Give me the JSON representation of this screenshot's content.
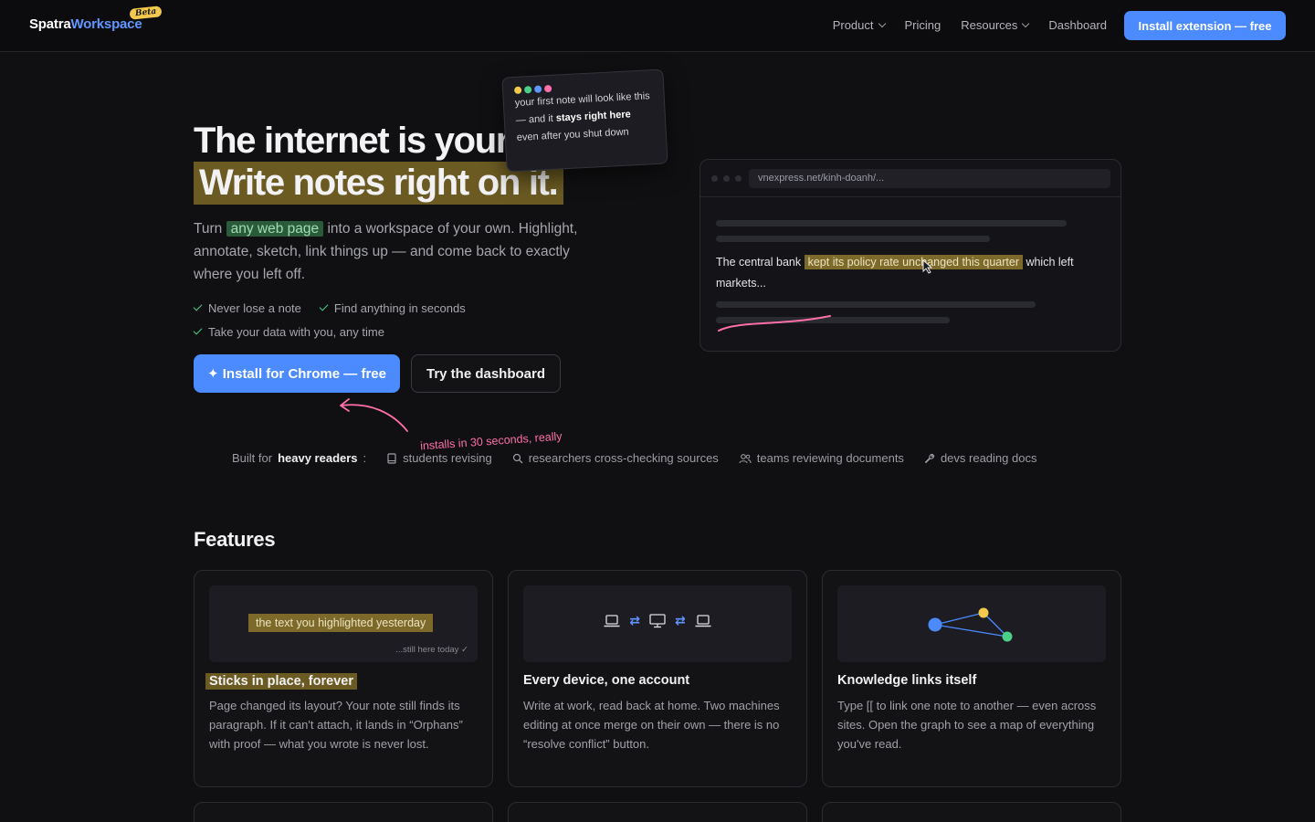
{
  "nav": {
    "logo_part1": "Spatra",
    "logo_part2": "Workspace",
    "beta": "Beta",
    "links": [
      {
        "label": "Product"
      },
      {
        "label": "Pricing"
      },
      {
        "label": "Resources"
      },
      {
        "label": "Dashboard"
      }
    ],
    "cta": "Install extension — free"
  },
  "hero": {
    "title_line1": "The internet is your",
    "title_line2": "Write notes right on it.",
    "para_before": "Turn ",
    "para_highlight": "any web page",
    "para_after": " into a workspace of your own. Highlight, annotate, sketch, link things up — and come back to exactly where you left off.",
    "checks": [
      "Never lose a note",
      "Find anything in seconds",
      "Take your data with you, any time"
    ],
    "primary_button": "✦ Install for Chrome — free",
    "secondary_button": "Try the dashboard",
    "hand_note": "installs in 30 seconds, really"
  },
  "sticky": {
    "text1": "your first note will look like this — and it ",
    "bold1": "stays right here",
    "text2": " even after you shut down",
    "dot_colors": [
      "#f2c94c",
      "#4ccf86",
      "#5f97ff",
      "#ff6fa8"
    ]
  },
  "browser": {
    "url": "vnexpress.net/kinh-doanh/...",
    "text_before": "The central bank ",
    "text_highlight": "kept its policy rate unchanged this quarter",
    "text_after": " which left markets..."
  },
  "built_for": {
    "prefix": "Built for",
    "emphasis": "heavy readers",
    "colon": ":",
    "audiences": [
      {
        "icon": "book-icon",
        "label": "students revising"
      },
      {
        "icon": "search-icon",
        "label": "researchers cross-checking sources"
      },
      {
        "icon": "users-icon",
        "label": "teams reviewing documents"
      },
      {
        "icon": "wrench-icon",
        "label": "devs reading docs"
      }
    ]
  },
  "features": {
    "title": "Features",
    "cards": [
      {
        "preview_highlight": "the text you highlighted yesterday",
        "preview_note": "...still here today ✓",
        "title": "Sticks in place, forever",
        "desc": "Page changed its layout? Your note still finds its paragraph. If it can't attach, it lands in “Orphans” with proof — what you wrote is never lost."
      },
      {
        "title": "Every device, one account",
        "desc": "Write at work, read back at home. Two machines editing at once merge on their own — there is no “resolve conflict” button."
      },
      {
        "title": "Knowledge links itself",
        "desc": "Type [[ to link one note to another — even across sites. Open the graph to see a map of everything you've read."
      }
    ]
  },
  "colors": {
    "accent": "#4b8bff",
    "highlight_yellow": "#6b5b22",
    "highlight_green": "#2b5a3b",
    "check_green": "#4ccf86",
    "pink": "#ff6fa8"
  }
}
